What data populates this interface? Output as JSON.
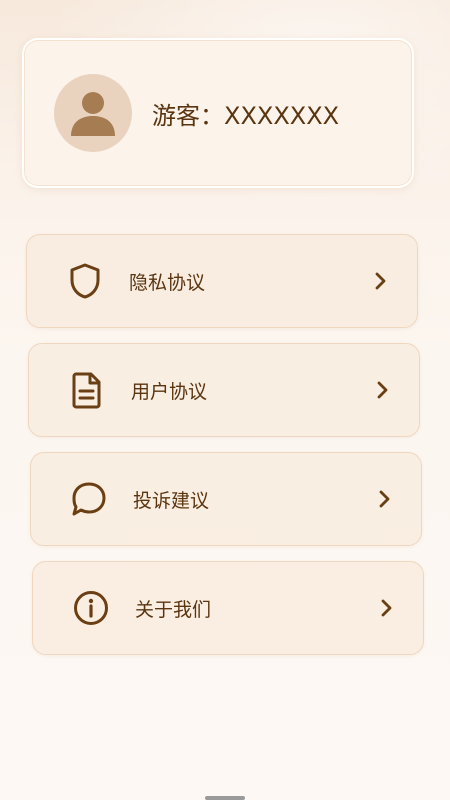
{
  "profile": {
    "avatar_icon": "user-avatar-icon",
    "guest_label": "游客：",
    "username": "XXXXXXX"
  },
  "menu": {
    "items": [
      {
        "label": "隐私协议",
        "icon": "shield-icon"
      },
      {
        "label": "用户协议",
        "icon": "document-icon"
      },
      {
        "label": "投诉建议",
        "icon": "chat-bubble-icon"
      },
      {
        "label": "关于我们",
        "icon": "info-icon"
      }
    ],
    "chevron_icon": "chevron-right-icon"
  },
  "colors": {
    "text_brown": "#5a3510",
    "avatar_bg": "#e9d3bf",
    "avatar_figure": "#a67c52",
    "card_border": "#efd7bf"
  }
}
